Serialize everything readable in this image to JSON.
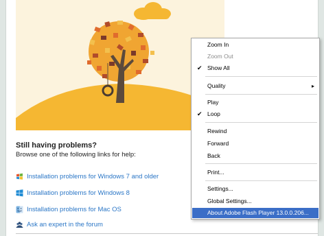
{
  "help": {
    "title": "Still having problems?",
    "subtitle": "Browse one of the following links for help:"
  },
  "links": [
    {
      "label": "Installation problems for Windows 7 and older",
      "icon": "windows7-icon"
    },
    {
      "label": "Installation problems for Windows 8",
      "icon": "windows8-icon"
    },
    {
      "label": "Installation problems for Mac OS",
      "icon": "mac-finder-icon"
    },
    {
      "label": "Ask an expert in the forum",
      "icon": "forum-people-icon"
    }
  ],
  "context_menu": {
    "items": [
      {
        "label": "Zoom In",
        "disabled": false,
        "checked": false
      },
      {
        "label": "Zoom Out",
        "disabled": true,
        "checked": false
      },
      {
        "label": "Show All",
        "disabled": false,
        "checked": true
      },
      {
        "label": "Quality",
        "disabled": false,
        "checked": false,
        "submenu": true
      },
      {
        "label": "Play",
        "disabled": false,
        "checked": false
      },
      {
        "label": "Loop",
        "disabled": false,
        "checked": true
      },
      {
        "label": "Rewind",
        "disabled": false,
        "checked": false
      },
      {
        "label": "Forward",
        "disabled": false,
        "checked": false
      },
      {
        "label": "Back",
        "disabled": false,
        "checked": false
      },
      {
        "label": "Print...",
        "disabled": false,
        "checked": false
      },
      {
        "label": "Settings...",
        "disabled": false,
        "checked": false
      },
      {
        "label": "Global Settings...",
        "disabled": false,
        "checked": false
      },
      {
        "label": "About Adobe Flash Player 13.0.0.206...",
        "disabled": false,
        "checked": false,
        "selected": true
      }
    ],
    "check_glyph": "✔",
    "submenu_glyph": "▸"
  },
  "colors": {
    "link": "#2a76c6",
    "menu_highlight": "#3b6ec7",
    "flash_bg": "#fcf3dd",
    "hill": "#f5b732",
    "tree_trunk": "#5b4a3c"
  }
}
